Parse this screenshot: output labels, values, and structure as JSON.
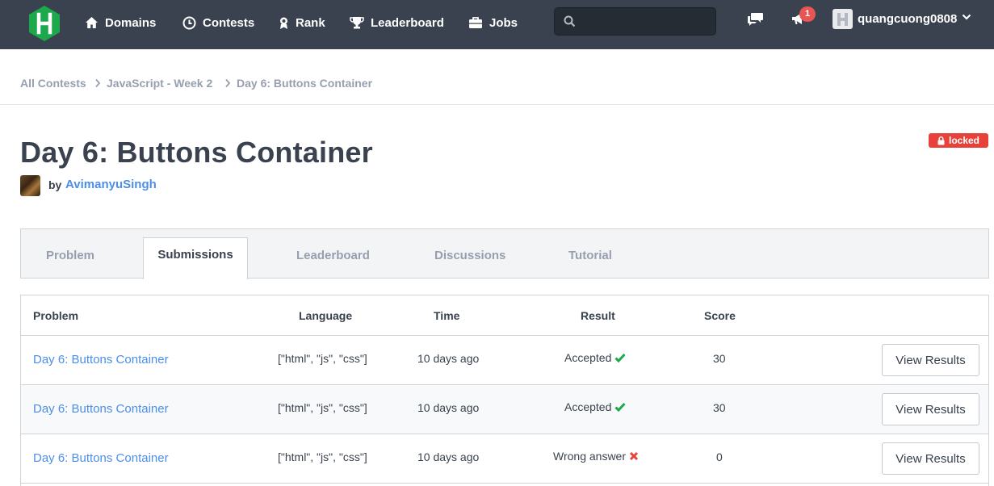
{
  "nav": {
    "items": [
      {
        "label": "Domains",
        "icon": "home-icon"
      },
      {
        "label": "Contests",
        "icon": "clock-icon"
      },
      {
        "label": "Rank",
        "icon": "medal-icon"
      },
      {
        "label": "Leaderboard",
        "icon": "trophy-icon"
      },
      {
        "label": "Jobs",
        "icon": "briefcase-icon"
      }
    ],
    "search": {
      "placeholder": "",
      "value": ""
    },
    "notification_count": "1",
    "username": "quangcuong0808"
  },
  "breadcrumb": [
    "All Contests",
    "JavaScript - Week 2",
    "Day 6: Buttons Container"
  ],
  "page": {
    "title": "Day 6: Buttons Container",
    "status_badge": "locked",
    "by_label": "by",
    "author": "AvimanyuSingh"
  },
  "tabs": [
    "Problem",
    "Submissions",
    "Leaderboard",
    "Discussions",
    "Tutorial"
  ],
  "active_tab": "Submissions",
  "table": {
    "headers": [
      "Problem",
      "Language",
      "Time",
      "Result",
      "Score"
    ],
    "rows": [
      {
        "problem": "Day 6: Buttons Container",
        "language": "[\"html\", \"js\", \"css\"]",
        "time": "10 days ago",
        "result": "Accepted",
        "status": "accepted",
        "score": "30",
        "action": "View Results"
      },
      {
        "problem": "Day 6: Buttons Container",
        "language": "[\"html\", \"js\", \"css\"]",
        "time": "10 days ago",
        "result": "Accepted",
        "status": "accepted",
        "score": "30",
        "action": "View Results"
      },
      {
        "problem": "Day 6: Buttons Container",
        "language": "[\"html\", \"js\", \"css\"]",
        "time": "10 days ago",
        "result": "Wrong answer",
        "status": "wrong",
        "score": "0",
        "action": "View Results"
      }
    ]
  },
  "colors": {
    "nav_bg": "#39424e",
    "brand_green": "#1ba94c",
    "link_blue": "#4c8ee8",
    "locked_red": "#e8413a",
    "accepted_green": "#1ba94c",
    "wrong_red": "#e8413a"
  }
}
